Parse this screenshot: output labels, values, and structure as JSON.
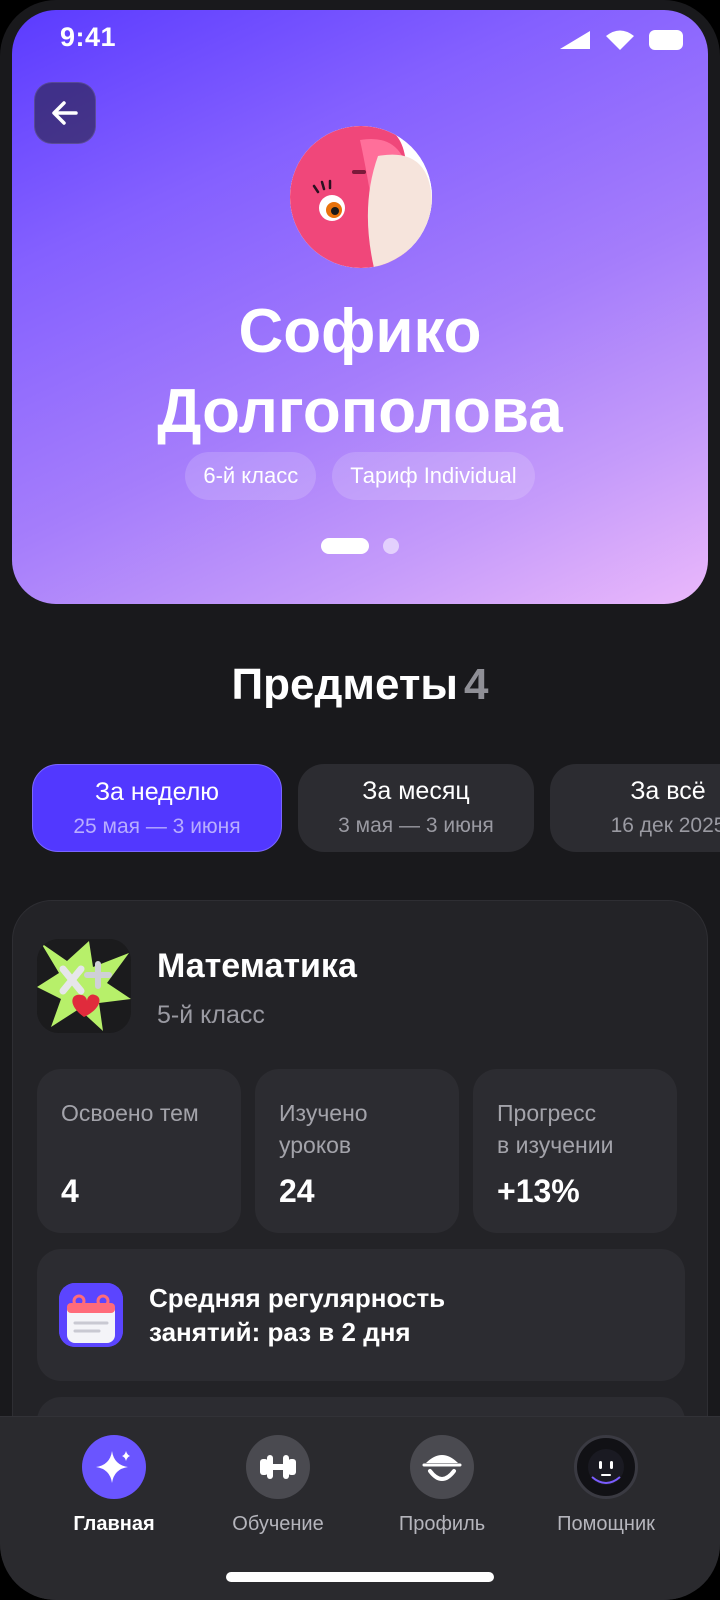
{
  "status": {
    "time": "9:41"
  },
  "profile": {
    "first_name": "Софико",
    "last_name": "Долгополова",
    "tags": [
      "6-й класс",
      "Тариф Individual"
    ]
  },
  "subjects": {
    "title": "Предметы",
    "count": "4"
  },
  "periods": [
    {
      "label": "За неделю",
      "range": "25 мая — 3 июня",
      "active": true
    },
    {
      "label": "За месяц",
      "range": "3 мая — 3 июня",
      "active": false
    },
    {
      "label": "За всё",
      "range": "16 дек 2025",
      "active": false
    }
  ],
  "subject_card": {
    "name": "Математика",
    "grade": "5-й  класс",
    "stats": [
      {
        "label": "Освоено тем",
        "value": "4"
      },
      {
        "label": "Изучено\nуроков",
        "value": "24"
      },
      {
        "label": "Прогресс\nв изучении",
        "value": "+13%"
      }
    ],
    "regularity": "Средняя регулярность\nзанятий: раз в 2 дня"
  },
  "nav": {
    "items": [
      {
        "label": "Главная",
        "icon": "sparkle-icon",
        "active": true
      },
      {
        "label": "Обучение",
        "icon": "dumbbell-icon",
        "active": false
      },
      {
        "label": "Профиль",
        "icon": "face-icon",
        "active": false
      },
      {
        "label": "Помощник",
        "icon": "robot-icon",
        "active": false
      }
    ]
  },
  "colors": {
    "accent": "#5238ff",
    "background": "#19191c",
    "card": "#232327"
  }
}
